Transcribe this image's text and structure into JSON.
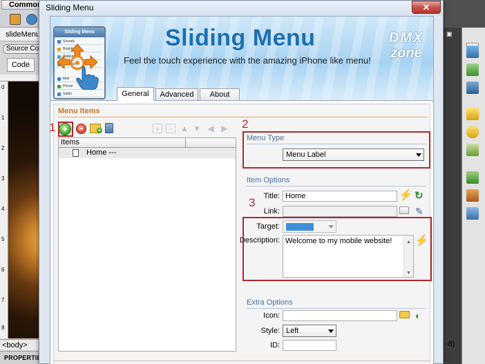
{
  "host": {
    "toolbar_tab": "Common",
    "document_tab": "slideMenu",
    "source_code": "Source Code",
    "code_button": "Code",
    "ruler_marks": [
      "0",
      "1",
      "2",
      "3",
      "4",
      "5",
      "6",
      "7",
      "8"
    ],
    "body_tag": "<body>",
    "properties_label": "PROPERTIES",
    "status_fragment": "-8)"
  },
  "dialog": {
    "title": "Sliding Menu",
    "close_label": "✕"
  },
  "banner": {
    "title": "Sliding Menu",
    "tagline": "Feel the touch experience with the amazing iPhone like menu!",
    "logo_line1": "DMX",
    "logo_line2": "zone",
    "phone_header": "Sliding Menu",
    "phone_rows": [
      "Sounds",
      "Brightness",
      "Wallpaper",
      "General",
      "Mail",
      "Phone",
      "Safari"
    ]
  },
  "tabs": [
    {
      "label": "General",
      "active": true
    },
    {
      "label": "Advanced",
      "active": false
    },
    {
      "label": "About",
      "active": false
    }
  ],
  "menu_items": {
    "section_title": "Menu Items",
    "list_header": "Items",
    "items": [
      {
        "label": "Home ---"
      }
    ]
  },
  "menu_type": {
    "section_title": "Menu Type",
    "selected": "Menu Label"
  },
  "item_options": {
    "section_title": "Item Options",
    "title_label": "Title:",
    "title_value": "Home",
    "link_label": "Link:",
    "link_value": "",
    "target_label": "Target:",
    "target_value": "",
    "description_label": "Description:",
    "description_value": "Welcome to my mobile website!"
  },
  "extra_options": {
    "section_title": "Extra Options",
    "icon_label": "Icon:",
    "icon_value": "",
    "style_label": "Style:",
    "style_value": "Left",
    "id_label": "ID:",
    "id_value": ""
  },
  "annotations": [
    "1",
    "2",
    "3"
  ],
  "colors": {
    "accent_orange": "#c8742b",
    "section_blue": "#4a6f9a",
    "annotation_red": "#b0262e",
    "banner_title_blue": "#1a6fb0"
  }
}
